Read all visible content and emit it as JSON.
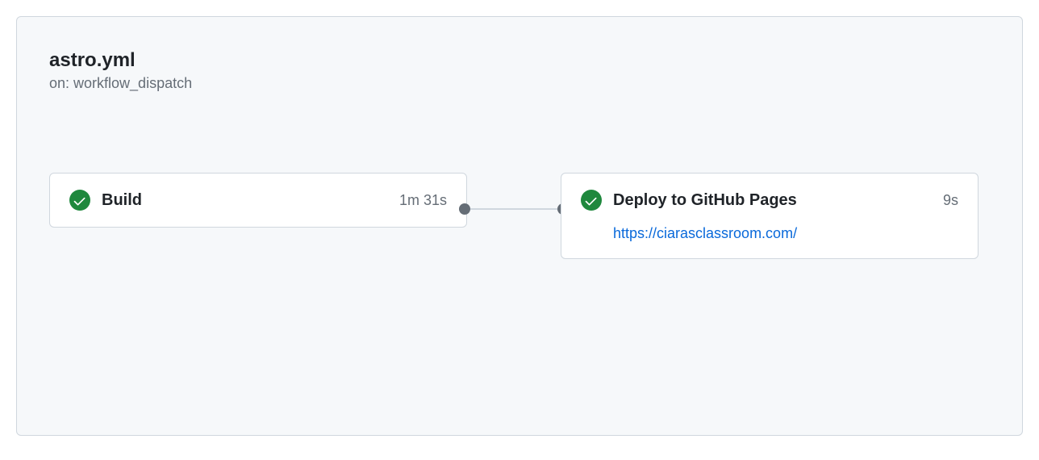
{
  "workflow": {
    "title": "astro.yml",
    "trigger_prefix": "on: ",
    "trigger": "workflow_dispatch"
  },
  "jobs": {
    "build": {
      "name": "Build",
      "duration": "1m 31s",
      "status": "success"
    },
    "deploy": {
      "name": "Deploy to GitHub Pages",
      "duration": "9s",
      "status": "success",
      "url": "https://ciarasclassroom.com/"
    }
  }
}
